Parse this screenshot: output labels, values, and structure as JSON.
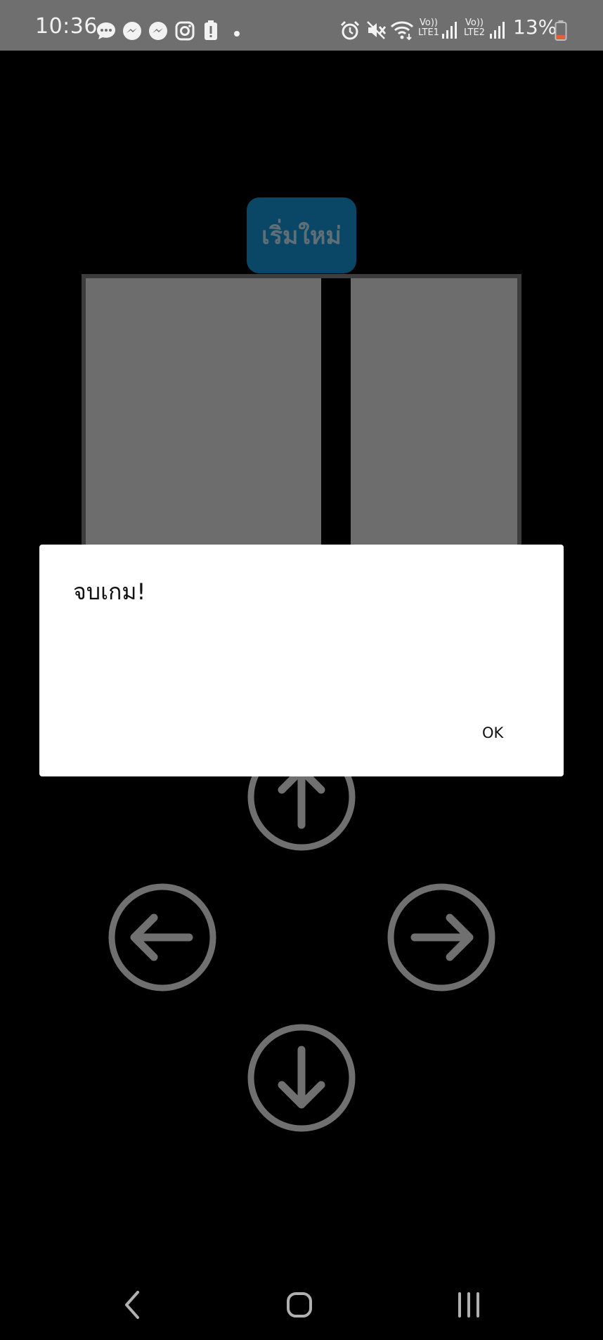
{
  "status_bar": {
    "time": "10:36",
    "battery_percent": "13%",
    "sim1_label": "LTE1",
    "sim2_label": "LTE2",
    "volte_label": "Vo))",
    "notification_icons": [
      "chat-bubble-icon",
      "messenger-icon",
      "messenger-icon",
      "instagram-icon",
      "battery-alert-icon",
      "dot-icon"
    ],
    "system_icons": [
      "alarm-icon",
      "mute-icon",
      "wifi-icon",
      "signal-icon",
      "signal-icon",
      "battery-icon"
    ],
    "background_color": "#6f6f6f",
    "battery_low_color": "#e0603a"
  },
  "game": {
    "restart_label": "เริ่มใหม่",
    "restart_color": "#0a4665"
  },
  "dpad": {
    "up": "arrow-up-icon",
    "left": "arrow-left-icon",
    "right": "arrow-right-icon",
    "down": "arrow-down-icon",
    "color": "#707070"
  },
  "dialog": {
    "message": "จบเกม!",
    "ok_label": "OK"
  },
  "nav_bar": {
    "back": "back-icon",
    "home": "home-icon",
    "recents": "recents-icon"
  }
}
